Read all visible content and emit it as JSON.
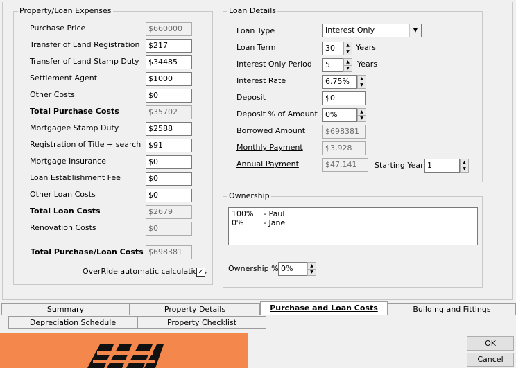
{
  "property_loan_expenses": {
    "title": "Property/Loan Expenses",
    "rows": [
      {
        "label": "Purchase Price",
        "value": "$660000",
        "readonly": true,
        "bold": false
      },
      {
        "label": "Transfer of Land Registration",
        "value": "$217",
        "readonly": false,
        "bold": false
      },
      {
        "label": "Transfer of Land Stamp Duty",
        "value": "$34485",
        "readonly": false,
        "bold": false
      },
      {
        "label": "Settlement Agent",
        "value": "$1000",
        "readonly": false,
        "bold": false
      },
      {
        "label": "Other Costs",
        "value": "$0",
        "readonly": false,
        "bold": false
      },
      {
        "label": "Total Purchase Costs",
        "value": "$35702",
        "readonly": true,
        "bold": true
      },
      {
        "label": "Mortgagee Stamp Duty",
        "value": "$2588",
        "readonly": false,
        "bold": false
      },
      {
        "label": "Registration of Title + search",
        "value": "$91",
        "readonly": false,
        "bold": false
      },
      {
        "label": "Mortgage Insurance",
        "value": "$0",
        "readonly": false,
        "bold": false
      },
      {
        "label": "Loan Establishment Fee",
        "value": "$0",
        "readonly": false,
        "bold": false
      },
      {
        "label": "Other Loan Costs",
        "value": "$0",
        "readonly": false,
        "bold": false
      },
      {
        "label": "Total Loan Costs",
        "value": "$2679",
        "readonly": true,
        "bold": true
      },
      {
        "label": "Renovation Costs",
        "value": "$0",
        "readonly": true,
        "bold": false
      }
    ],
    "total_purchase_loan": {
      "label": "Total Purchase/Loan Costs",
      "value": "$698381"
    },
    "override": {
      "label": "OverRide automatic calculations",
      "checked": true,
      "check_mark": "✓"
    }
  },
  "loan_details": {
    "title": "Loan Details",
    "loan_type": {
      "label": "Loan Type",
      "value": "Interest Only"
    },
    "loan_term": {
      "label": "Loan Term",
      "value": "30",
      "unit": "Years"
    },
    "io_period": {
      "label": "Interest Only Period",
      "value": "5",
      "unit": "Years"
    },
    "interest_rate": {
      "label": "Interest Rate",
      "value": "6.75%"
    },
    "deposit": {
      "label": "Deposit",
      "value": "$0"
    },
    "deposit_pct": {
      "label": "Deposit % of Amount",
      "value": "0%"
    },
    "borrowed": {
      "label": "Borrowed Amount",
      "value": "$698381"
    },
    "monthly": {
      "label": "Monthly Payment",
      "value": "$3,928"
    },
    "annual": {
      "label": "Annual Payment",
      "value": "$47,141"
    },
    "starting_year": {
      "label": "Starting Year",
      "value": "1"
    }
  },
  "ownership": {
    "title": "Ownership",
    "owners": [
      {
        "pct": "100%",
        "name": "- Paul"
      },
      {
        "pct": "0%",
        "name": "- Jane"
      }
    ],
    "pct_label": "Ownership %",
    "pct_value": "0%"
  },
  "tabs": {
    "row1": [
      "Summary",
      "Property Details",
      "Purchase and Loan Costs",
      "Building and Fittings"
    ],
    "row2": [
      "Depreciation Schedule",
      "Property Checklist"
    ],
    "active": "Purchase and Loan Costs"
  },
  "buttons": {
    "ok": "OK",
    "cancel": "Cancel"
  },
  "colors": {
    "banner": "#f4874b",
    "logo": "#111111"
  },
  "spin_up": "▲",
  "spin_down": "▼",
  "combo_arrow": "▼"
}
